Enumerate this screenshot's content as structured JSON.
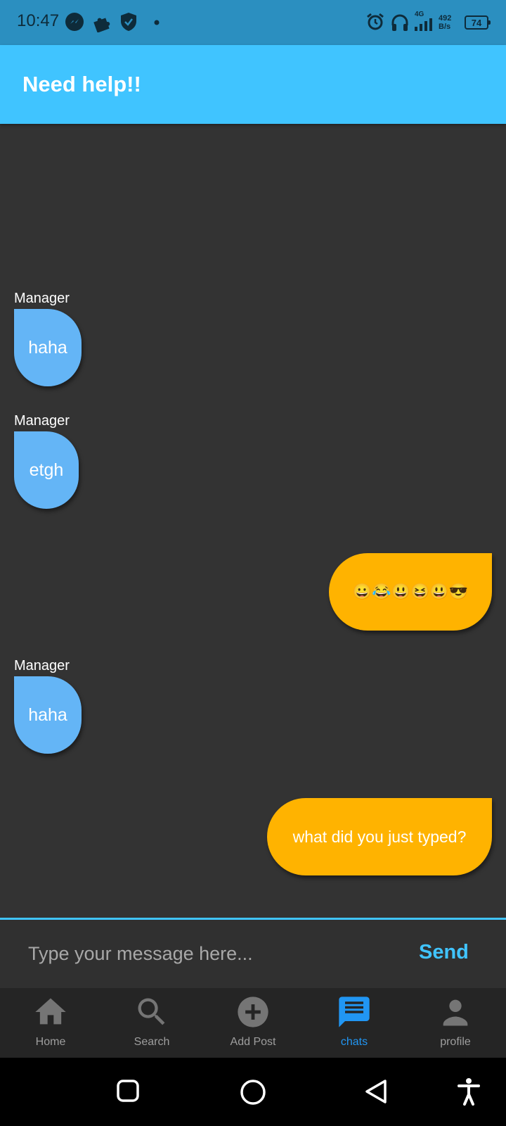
{
  "status_bar": {
    "time": "10:47",
    "net_speed_value": "492",
    "net_speed_unit": "B/s",
    "network_type": "4G",
    "battery": "74",
    "icons": [
      "messenger-icon",
      "puzzle-icon",
      "shield-icon",
      "notification-dot-icon",
      "alarm-icon",
      "headphones-icon",
      "signal-icon",
      "battery-icon"
    ]
  },
  "app_bar": {
    "title": "Need help!!"
  },
  "messages": [
    {
      "sender": "Manager",
      "text": "haha",
      "direction": "received"
    },
    {
      "sender": "Manager",
      "text": "etgh",
      "direction": "received"
    },
    {
      "sender": "",
      "text": "😀😂😃😆😃😎",
      "direction": "sent"
    },
    {
      "sender": "Manager",
      "text": "haha",
      "direction": "received"
    },
    {
      "sender": "",
      "text": "what did you just typed?",
      "direction": "sent"
    }
  ],
  "composer": {
    "placeholder": "Type your message here...",
    "value": "",
    "send_label": "Send"
  },
  "bottom_nav": {
    "items": [
      {
        "label": "Home",
        "icon": "home-icon",
        "active": false
      },
      {
        "label": "Search",
        "icon": "search-icon",
        "active": false
      },
      {
        "label": "Add Post",
        "icon": "add-circle-icon",
        "active": false
      },
      {
        "label": "chats",
        "icon": "chat-icon",
        "active": true
      },
      {
        "label": "profile",
        "icon": "person-icon",
        "active": false
      }
    ]
  },
  "system_nav": {
    "buttons": [
      "recents-button",
      "home-button",
      "back-button",
      "accessibility-button"
    ]
  },
  "colors": {
    "status_bar": "#2b8fc0",
    "app_bar": "#40c4ff",
    "background": "#333333",
    "received_bubble": "#64b5f6",
    "sent_bubble": "#ffb300",
    "active_nav": "#2196f3",
    "send": "#40c4ff"
  }
}
